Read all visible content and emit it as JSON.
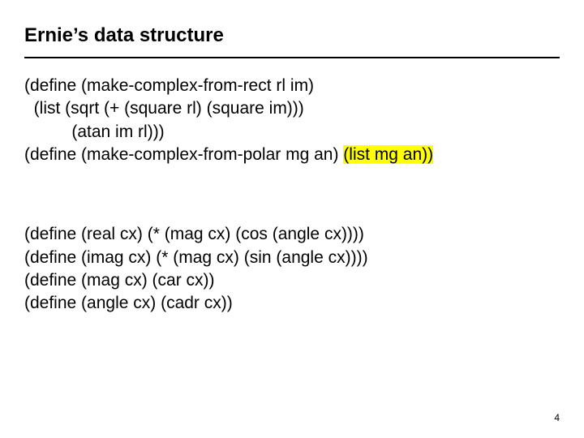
{
  "title": "Ernie’s data structure",
  "block1": {
    "line1": "(define (make-complex-from-rect rl im)",
    "line2": "  (list (sqrt (+ (square rl) (square im)))",
    "line3": "          (atan im rl)))",
    "line4a": "(define (make-complex-from-polar mg an) ",
    "line4b": "(list mg an))"
  },
  "block2": {
    "line1": "(define (real cx) (* (mag cx) (cos (angle cx))))",
    "line2": "(define (imag cx) (* (mag cx) (sin (angle cx))))",
    "line3": "(define (mag cx) (car cx))",
    "line4": "(define (angle cx) (cadr cx))"
  },
  "page_number": "4"
}
